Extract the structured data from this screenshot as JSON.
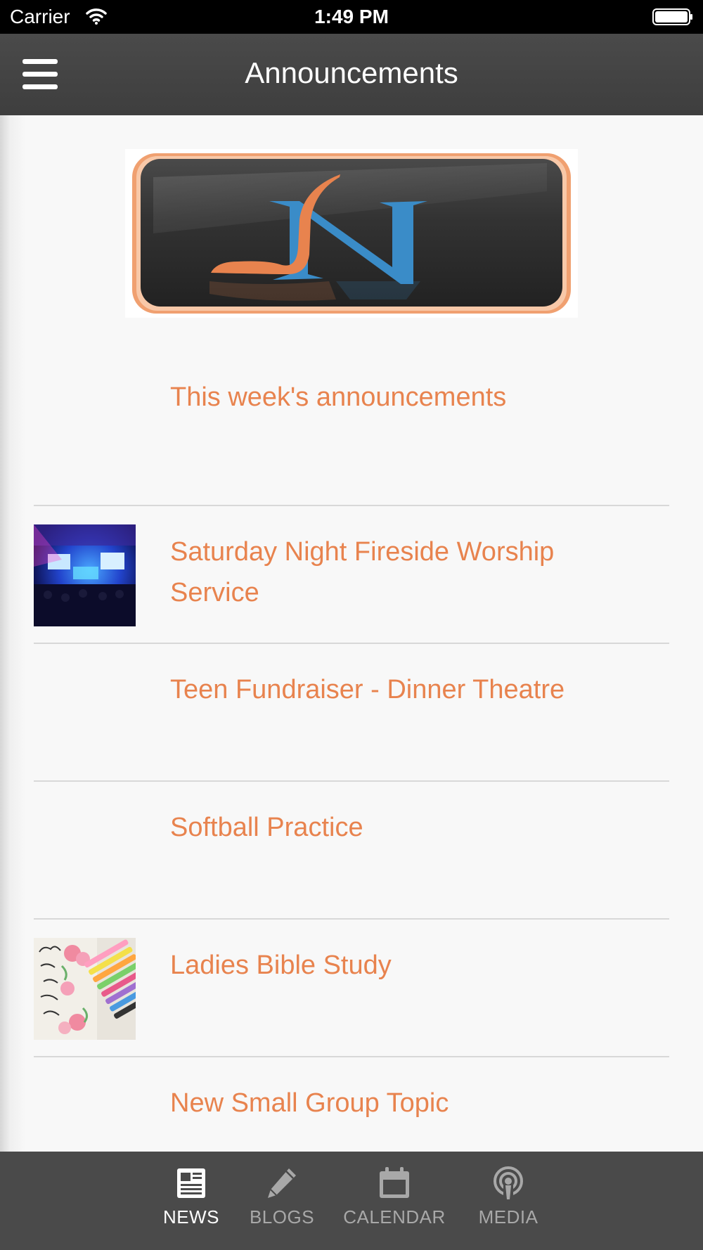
{
  "status_bar": {
    "carrier": "Carrier",
    "time": "1:49 PM"
  },
  "header": {
    "title": "Announcements"
  },
  "colors": {
    "accent": "#e8834e",
    "header_bg": "#444444",
    "tab_bar_bg": "#4a4a4a",
    "logo_blue": "#3a8cc8"
  },
  "logo": {
    "letters": "JN"
  },
  "news": {
    "items": [
      {
        "title": "This week's announcements",
        "has_thumbnail": false
      },
      {
        "title": "Saturday Night Fireside Worship Service",
        "has_thumbnail": true,
        "thumbnail_icon": "worship-stage-photo"
      },
      {
        "title": "Teen Fundraiser - Dinner Theatre",
        "has_thumbnail": false
      },
      {
        "title": "Softball Practice",
        "has_thumbnail": false
      },
      {
        "title": "Ladies Bible Study",
        "has_thumbnail": true,
        "thumbnail_icon": "bible-journaling-photo"
      },
      {
        "title": "New Small Group Topic",
        "has_thumbnail": false
      }
    ]
  },
  "tabs": [
    {
      "label": "NEWS",
      "icon": "newspaper-icon",
      "active": true
    },
    {
      "label": "BLOGS",
      "icon": "pencil-icon",
      "active": false
    },
    {
      "label": "CALENDAR",
      "icon": "calendar-icon",
      "active": false
    },
    {
      "label": "MEDIA",
      "icon": "podcast-icon",
      "active": false
    }
  ]
}
